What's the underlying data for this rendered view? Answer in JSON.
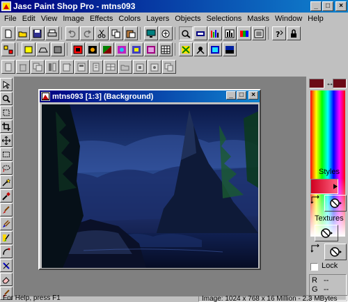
{
  "window": {
    "title": "Jasc Paint Shop Pro - mtns093",
    "minimize_label": "_",
    "maximize_label": "□",
    "close_label": "×"
  },
  "menu": [
    "File",
    "Edit",
    "View",
    "Image",
    "Effects",
    "Colors",
    "Layers",
    "Objects",
    "Selections",
    "Masks",
    "Window",
    "Help"
  ],
  "toolbar1": [
    "new-icon",
    "open-icon",
    "save-icon",
    "print-icon",
    "undo-icon",
    "redo-icon",
    "cut-icon",
    "copy-icon",
    "paste-icon",
    "screen-icon",
    "browse-icon",
    "zoom-icon",
    "layers-icon",
    "histogram-icon",
    "color-palette-icon",
    "overview-icon",
    "help-icon",
    "lock-icon"
  ],
  "toolbar2": [
    "tile-icon",
    "fill-yellow-icon",
    "flip-icon",
    "image-icon",
    "frame-icon",
    "flower-icon",
    "gradient-icon",
    "sphere-icon",
    "pattern-icon",
    "layer-icon",
    "grid-icon",
    "effect-icon",
    "cross-icon",
    "balance-icon",
    "color-icon",
    "filter-icon"
  ],
  "toolbar3": [
    "page-icon",
    "trash-icon",
    "layer-copy-icon",
    "column-icon",
    "new-doc-icon",
    "stamp-icon",
    "page-alt-icon",
    "table-icon",
    "folder-icon",
    "paste-icon-2",
    "target-icon",
    "copy-icon-2"
  ],
  "tools": [
    "arrow-icon",
    "zoom-tool-icon",
    "deformation-icon",
    "crop-icon",
    "move-icon",
    "selection-icon",
    "lasso-icon",
    "magic-wand-icon",
    "dropper-icon",
    "paint-brush-icon",
    "clone-brush-icon",
    "color-replacer-icon",
    "retouch-icon",
    "scratch-remover-icon",
    "eraser-icon",
    "picture-tube-icon"
  ],
  "document": {
    "title": "mtns093 [1:3] (Background)"
  },
  "colors": {
    "foreground": "#6b0a16",
    "background": "#6b0a16",
    "swap_label": "↔"
  },
  "styles_label": "Styles",
  "textures_label": "Textures",
  "lock_label": "Lock",
  "rgb": {
    "r_label": "R",
    "g_label": "G",
    "r_value": "--",
    "g_value": "--"
  },
  "status": {
    "help": "For Help, press F1",
    "info": "Image: 1024 x 768 x 16 Million - 2.3 MBytes"
  }
}
